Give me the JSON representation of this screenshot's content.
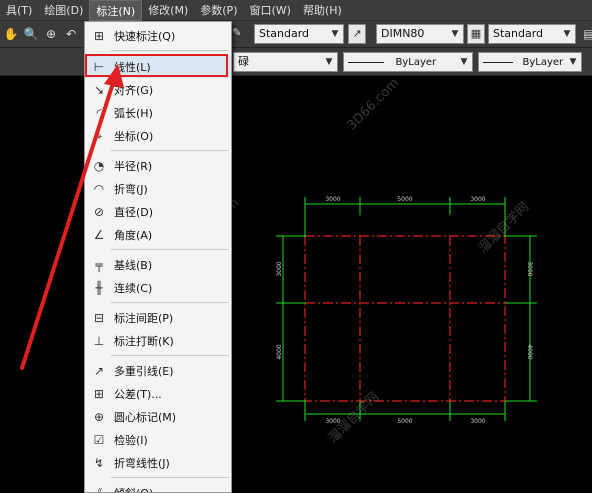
{
  "menubar": {
    "items": [
      "具(T)",
      "绘图(D)",
      "标注(N)",
      "修改(M)",
      "参数(P)",
      "窗口(W)",
      "帮助(H)"
    ]
  },
  "toolbar": {
    "text_style": "Standard",
    "dim_style": "DIMN80",
    "table_style": "Standard",
    "linetype": "ByLayer",
    "lineweight": "ByLayer",
    "layer_partial": "碌"
  },
  "dimension_menu": {
    "items": [
      {
        "label": "快速标注(Q)",
        "icon": "quick-dimension-icon"
      },
      {
        "label": "线性(L)",
        "icon": "linear-dimension-icon"
      },
      {
        "label": "对齐(G)",
        "icon": "aligned-dimension-icon"
      },
      {
        "label": "弧长(H)",
        "icon": "arc-length-icon"
      },
      {
        "label": "坐标(O)",
        "icon": "ordinate-icon"
      },
      {
        "label": "半径(R)",
        "icon": "radius-icon"
      },
      {
        "label": "折弯(J)",
        "icon": "jogged-icon"
      },
      {
        "label": "直径(D)",
        "icon": "diameter-icon"
      },
      {
        "label": "角度(A)",
        "icon": "angular-icon"
      },
      {
        "label": "基线(B)",
        "icon": "baseline-icon"
      },
      {
        "label": "连续(C)",
        "icon": "continue-icon"
      },
      {
        "label": "标注间距(P)",
        "icon": "dimension-space-icon"
      },
      {
        "label": "标注打断(K)",
        "icon": "dimension-break-icon"
      },
      {
        "label": "多重引线(E)",
        "icon": "multileader-icon"
      },
      {
        "label": "公差(T)...",
        "icon": "tolerance-icon"
      },
      {
        "label": "圆心标记(M)",
        "icon": "center-mark-icon"
      },
      {
        "label": "检验(I)",
        "icon": "inspection-icon"
      },
      {
        "label": "折弯线性(J)",
        "icon": "jogged-linear-icon"
      },
      {
        "label": "倾斜(Q)",
        "icon": "oblique-icon"
      }
    ]
  },
  "drawing": {
    "top_dims": [
      "3000",
      "5000",
      "3000"
    ],
    "bottom_dims": [
      "3000",
      "5000",
      "3000"
    ],
    "left_dims": [
      "3000",
      "4000"
    ],
    "right_dims": [
      "3000",
      "4000"
    ]
  },
  "watermarks": [
    "3D66.com",
    "溜溜自学网",
    "3D66.com",
    "溜溜自学网"
  ],
  "colors": {
    "highlight_box": "#e02020",
    "arrow": "#e02020",
    "dim_lines": "#22dd22",
    "grid_lines": "#dd2222"
  }
}
